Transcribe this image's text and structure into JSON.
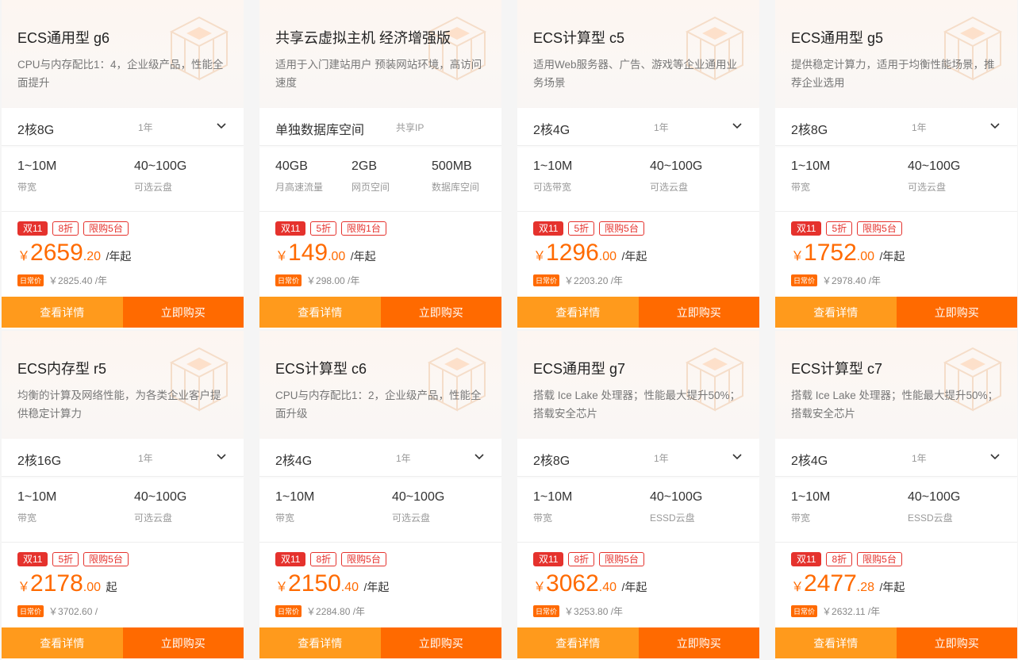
{
  "cards": [
    {
      "title": "ECS通用型 g6",
      "desc": "CPU与内存配比1：4，企业级产品，性能全面提升",
      "spec": "2核8G",
      "term": "1年",
      "stats": [
        {
          "v": "1~10M",
          "l": "带宽"
        },
        {
          "v": "40~100G",
          "l": "可选云盘"
        }
      ],
      "tags": [
        "双11",
        "8折",
        "限购5台"
      ],
      "cur": "￥",
      "int": "2659",
      "dec": ".20",
      "unit": "/年起",
      "badge": "日常价",
      "orig": "￥2825.40 /年",
      "detail": "查看详情",
      "buy": "立即购买"
    },
    {
      "title": "共享云虚拟主机 经济增强版",
      "desc": "适用于入门建站用户 预装网站环境，高访问速度",
      "spec": "单独数据库空间",
      "term": "共享IP",
      "stats": [
        {
          "v": "40GB",
          "l": "月高速流量"
        },
        {
          "v": "2GB",
          "l": "网页空间"
        },
        {
          "v": "500MB",
          "l": "数据库空间"
        }
      ],
      "tags": [
        "双11",
        "5折",
        "限购1台"
      ],
      "cur": "￥",
      "int": "149",
      "dec": ".00",
      "unit": "/年起",
      "badge": "日常价",
      "orig": "￥298.00 /年",
      "detail": "查看详情",
      "buy": "立即购买"
    },
    {
      "title": "ECS计算型 c5",
      "desc": "适用Web服务器、广告、游戏等企业通用业务场景",
      "spec": "2核4G",
      "term": "1年",
      "stats": [
        {
          "v": "1~10M",
          "l": "可选带宽"
        },
        {
          "v": "40~100G",
          "l": "可选云盘"
        }
      ],
      "tags": [
        "双11",
        "5折",
        "限购5台"
      ],
      "cur": "￥",
      "int": "1296",
      "dec": ".00",
      "unit": "/年起",
      "badge": "日常价",
      "orig": "￥2203.20 /年",
      "detail": "查看详情",
      "buy": "立即购买"
    },
    {
      "title": "ECS通用型 g5",
      "desc": "提供稳定计算力，适用于均衡性能场景，推荐企业选用",
      "spec": "2核8G",
      "term": "1年",
      "stats": [
        {
          "v": "1~10M",
          "l": "带宽"
        },
        {
          "v": "40~100G",
          "l": "可选云盘"
        }
      ],
      "tags": [
        "双11",
        "5折",
        "限购5台"
      ],
      "cur": "￥",
      "int": "1752",
      "dec": ".00",
      "unit": "/年起",
      "badge": "日常价",
      "orig": "￥2978.40 /年",
      "detail": "查看详情",
      "buy": "立即购买"
    },
    {
      "title": "ECS内存型 r5",
      "desc": "均衡的计算及网络性能，为各类企业客户提供稳定计算力",
      "spec": "2核16G",
      "term": "1年",
      "stats": [
        {
          "v": "1~10M",
          "l": "带宽"
        },
        {
          "v": "40~100G",
          "l": "可选云盘"
        }
      ],
      "tags": [
        "双11",
        "5折",
        "限购5台"
      ],
      "cur": "￥",
      "int": "2178",
      "dec": ".00",
      "unit": "起",
      "badge": "日常价",
      "orig": "￥3702.60 /",
      "detail": "查看详情",
      "buy": "立即购买"
    },
    {
      "title": "ECS计算型 c6",
      "desc": "CPU与内存配比1：2，企业级产品，性能全面升级",
      "spec": "2核4G",
      "term": "1年",
      "stats": [
        {
          "v": "1~10M",
          "l": "带宽"
        },
        {
          "v": "40~100G",
          "l": "可选云盘"
        }
      ],
      "tags": [
        "双11",
        "8折",
        "限购5台"
      ],
      "cur": "￥",
      "int": "2150",
      "dec": ".40",
      "unit": "/年起",
      "badge": "日常价",
      "orig": "￥2284.80 /年",
      "detail": "查看详情",
      "buy": "立即购买"
    },
    {
      "title": "ECS通用型 g7",
      "desc": "搭载 Ice Lake 处理器；性能最大提升50%；搭载安全芯片",
      "spec": "2核8G",
      "term": "1年",
      "stats": [
        {
          "v": "1~10M",
          "l": "带宽"
        },
        {
          "v": "40~100G",
          "l": "ESSD云盘"
        }
      ],
      "tags": [
        "双11",
        "8折",
        "限购5台"
      ],
      "cur": "￥",
      "int": "3062",
      "dec": ".40",
      "unit": "/年起",
      "badge": "日常价",
      "orig": "￥3253.80 /年",
      "detail": "查看详情",
      "buy": "立即购买"
    },
    {
      "title": "ECS计算型 c7",
      "desc": "搭载 Ice Lake 处理器；性能最大提升50%；搭载安全芯片",
      "spec": "2核4G",
      "term": "1年",
      "stats": [
        {
          "v": "1~10M",
          "l": "带宽"
        },
        {
          "v": "40~100G",
          "l": "ESSD云盘"
        }
      ],
      "tags": [
        "双11",
        "8折",
        "限购5台"
      ],
      "cur": "￥",
      "int": "2477",
      "dec": ".28",
      "unit": "/年起",
      "badge": "日常价",
      "orig": "￥2632.11 /年",
      "detail": "查看详情",
      "buy": "立即购买"
    }
  ]
}
